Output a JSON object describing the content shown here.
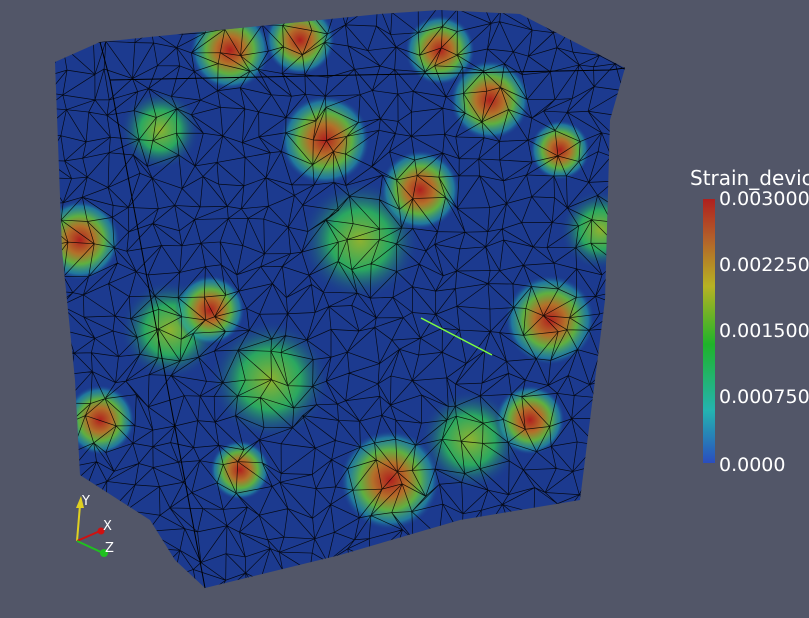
{
  "legend": {
    "title": "Strain_devic",
    "ticks": [
      "0.003000",
      "0.002250",
      "0.001500",
      "0.000750",
      "0.0000"
    ],
    "range": [
      0,
      0.003
    ],
    "colormap": [
      "#2a4dbf",
      "#24b4b0",
      "#1fb32a",
      "#b7b223",
      "#b0201e"
    ]
  },
  "orientation_axes": {
    "x": "X",
    "y": "Y",
    "z": "Z",
    "x_color": "#d01010",
    "y_color": "#e0d020",
    "z_color": "#20c020"
  },
  "background": "#525668"
}
